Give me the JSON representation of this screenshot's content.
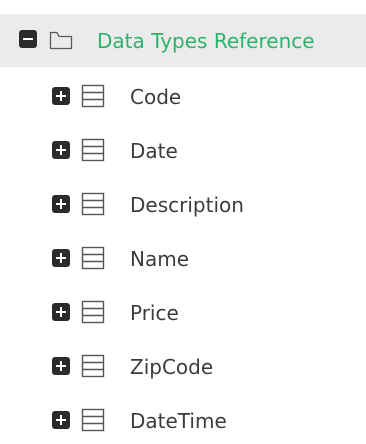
{
  "tree": {
    "root": {
      "label": "Data Types Reference",
      "expanded": true,
      "toggle_icon": "collapse-minus-icon",
      "node_icon": "folder-icon",
      "label_color": "#2db36b",
      "row_background": "#ebebeb"
    },
    "children": [
      {
        "label": "Code"
      },
      {
        "label": "Date"
      },
      {
        "label": "Description"
      },
      {
        "label": "Name"
      },
      {
        "label": "Price"
      },
      {
        "label": "ZipCode"
      },
      {
        "label": "DateTime"
      }
    ],
    "child_toggle_icon": "expand-plus-icon",
    "child_node_icon": "table-icon"
  }
}
